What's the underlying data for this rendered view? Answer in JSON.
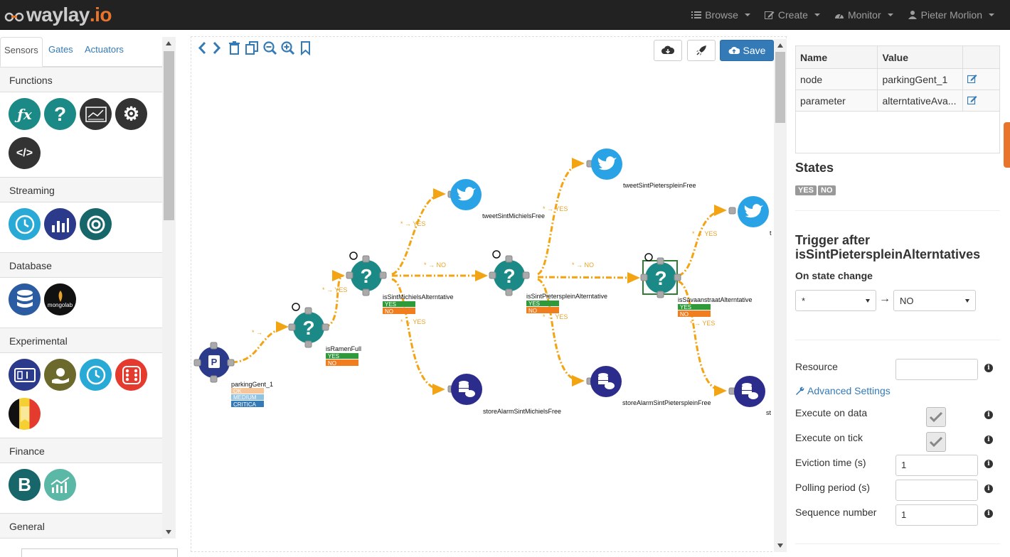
{
  "brand": {
    "name": "waylay",
    "suffix": ".io"
  },
  "nav": {
    "browse": "Browse",
    "create": "Create",
    "monitor": "Monitor",
    "user": "Pieter Morlion"
  },
  "tabs": [
    "Sensors",
    "Gates",
    "Actuators"
  ],
  "categories": {
    "functions": "Functions",
    "streaming": "Streaming",
    "database": "Database",
    "experimental": "Experimental",
    "finance": "Finance",
    "general": "General"
  },
  "icons": {
    "fx": "ƒx",
    "question": "?",
    "mongolab": "mongolab",
    "bitcoin": "B"
  },
  "toolbar": {
    "save": "Save"
  },
  "flow": {
    "nodes": {
      "parking": "parkingGent_1",
      "ramen": "isRamenFull",
      "michiels": "isSintMichielsAlterntative",
      "pieters": "isSintPieterspleinAlterntative",
      "savaan": "isSavaanstraatAlterntative",
      "tweet1": "tweetSintMichielsFree",
      "tweet2": "tweetSintPieterspleinFree",
      "store1": "storeAlarmSintMichielsFree",
      "store2": "storeAlarmSintPieterspleinFree",
      "tweet3_cut": "t",
      "store3_cut": "st"
    },
    "states": {
      "ok": "OK",
      "medium": "MEDIUM",
      "critical": "CRITICA",
      "yes": "YES",
      "no": "NO"
    },
    "edges": {
      "star_arrow": "* →",
      "yes": "YES",
      "no": "NO",
      "star_yes": "* → YES",
      "star_no": "* → NO"
    }
  },
  "props": {
    "headers": [
      "Name",
      "Value"
    ],
    "rows": [
      {
        "name": "node",
        "value": "parkingGent_1"
      },
      {
        "name": "parameter",
        "value": "alterntativeAva..."
      }
    ]
  },
  "states_title": "States",
  "state_labels": [
    "YES",
    "NO"
  ],
  "trigger": {
    "title": "Trigger after isSintPieterspleinAlterntatives",
    "subtitle": "On state change",
    "from": "*",
    "to": "NO",
    "arrow": "→"
  },
  "settings": {
    "resource": "Resource",
    "advanced": "Advanced Settings",
    "exec_data": "Execute on data",
    "exec_tick": "Execute on tick",
    "eviction": "Eviction time (s)",
    "eviction_value": "1",
    "polling": "Polling period (s)",
    "sequence": "Sequence number",
    "sequence_value": "1"
  }
}
